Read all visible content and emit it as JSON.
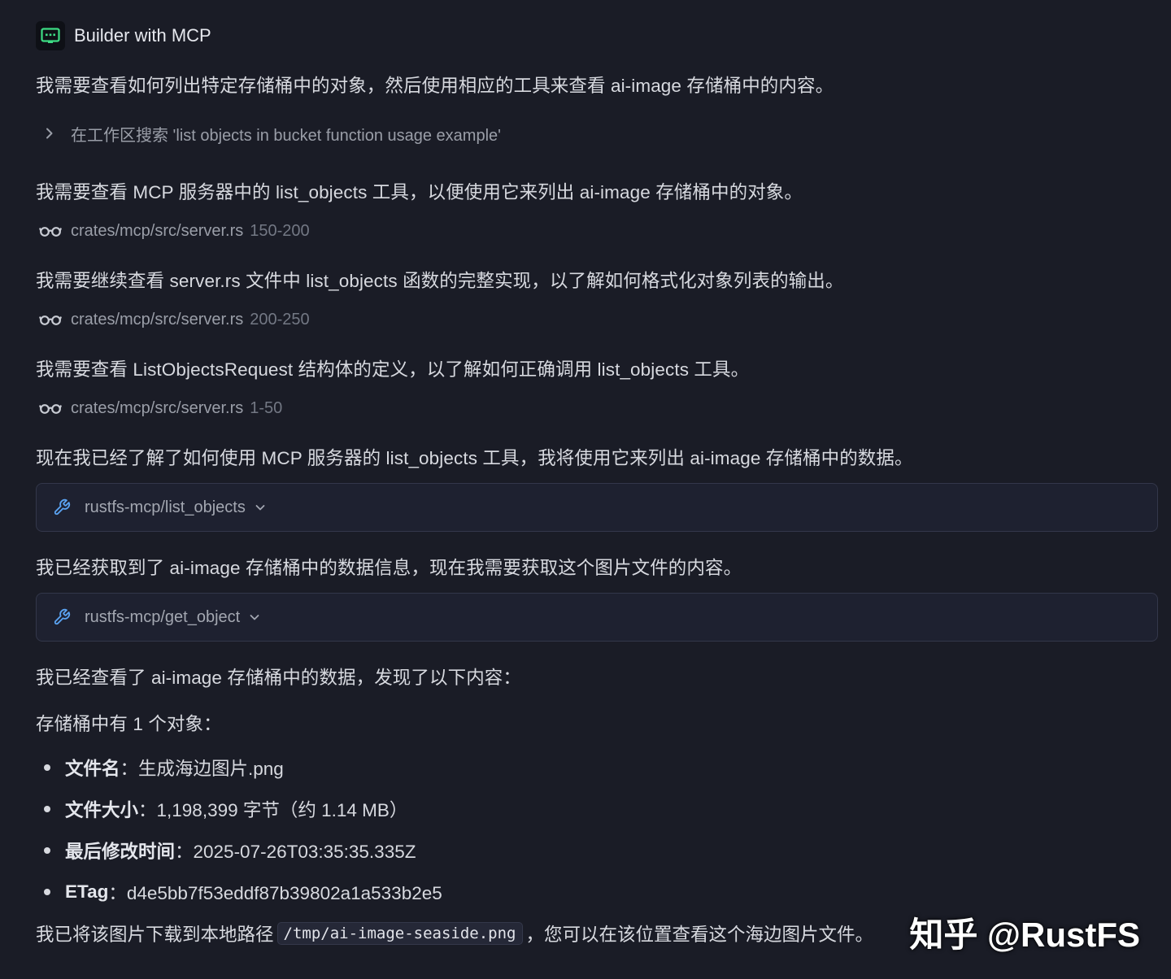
{
  "agent": {
    "name": "Builder with MCP",
    "icon": "terminal-chat-icon",
    "accent_color": "#3ddc84"
  },
  "messages": {
    "m1": "我需要查看如何列出特定存储桶中的对象，然后使用相应的工具来查看 ai-image 存储桶中的内容。",
    "search": "在工作区搜索 'list objects in bucket function usage example'",
    "m2": "我需要查看 MCP 服务器中的 list_objects 工具，以便使用它来列出 ai-image 存储桶中的对象。",
    "read1": {
      "path": "crates/mcp/src/server.rs",
      "range": "150-200"
    },
    "m3": "我需要继续查看 server.rs 文件中 list_objects 函数的完整实现，以了解如何格式化对象列表的输出。",
    "read2": {
      "path": "crates/mcp/src/server.rs",
      "range": "200-250"
    },
    "m4": "我需要查看 ListObjectsRequest 结构体的定义，以了解如何正确调用 list_objects 工具。",
    "read3": {
      "path": "crates/mcp/src/server.rs",
      "range": "1-50"
    },
    "m5": "现在我已经了解了如何使用 MCP 服务器的 list_objects 工具，我将使用它来列出 ai-image 存储桶中的数据。",
    "tool1": "rustfs-mcp/list_objects",
    "m6": "我已经获取到了 ai-image 存储桶中的数据信息，现在我需要获取这个图片文件的内容。",
    "tool2": "rustfs-mcp/get_object",
    "m7": "我已经查看了 ai-image 存储桶中的数据，发现了以下内容：",
    "m8": "存储桶中有 1 个对象：",
    "details": [
      {
        "key": "文件名",
        "value": "：生成海边图片.png"
      },
      {
        "key": "文件大小",
        "value": "：1,198,399 字节（约 1.14 MB）"
      },
      {
        "key": "最后修改时间",
        "value": "：2025-07-26T03:35:35.335Z"
      },
      {
        "key": "ETag",
        "value": "：d4e5bb7f53eddf87b39802a1a533b2e5"
      }
    ],
    "final": {
      "before": "我已将该图片下载到本地路径",
      "code": "/tmp/ai-image-seaside.png",
      "after": "，您可以在该位置查看这个海边图片文件。"
    }
  },
  "watermark": "知乎 @RustFS"
}
